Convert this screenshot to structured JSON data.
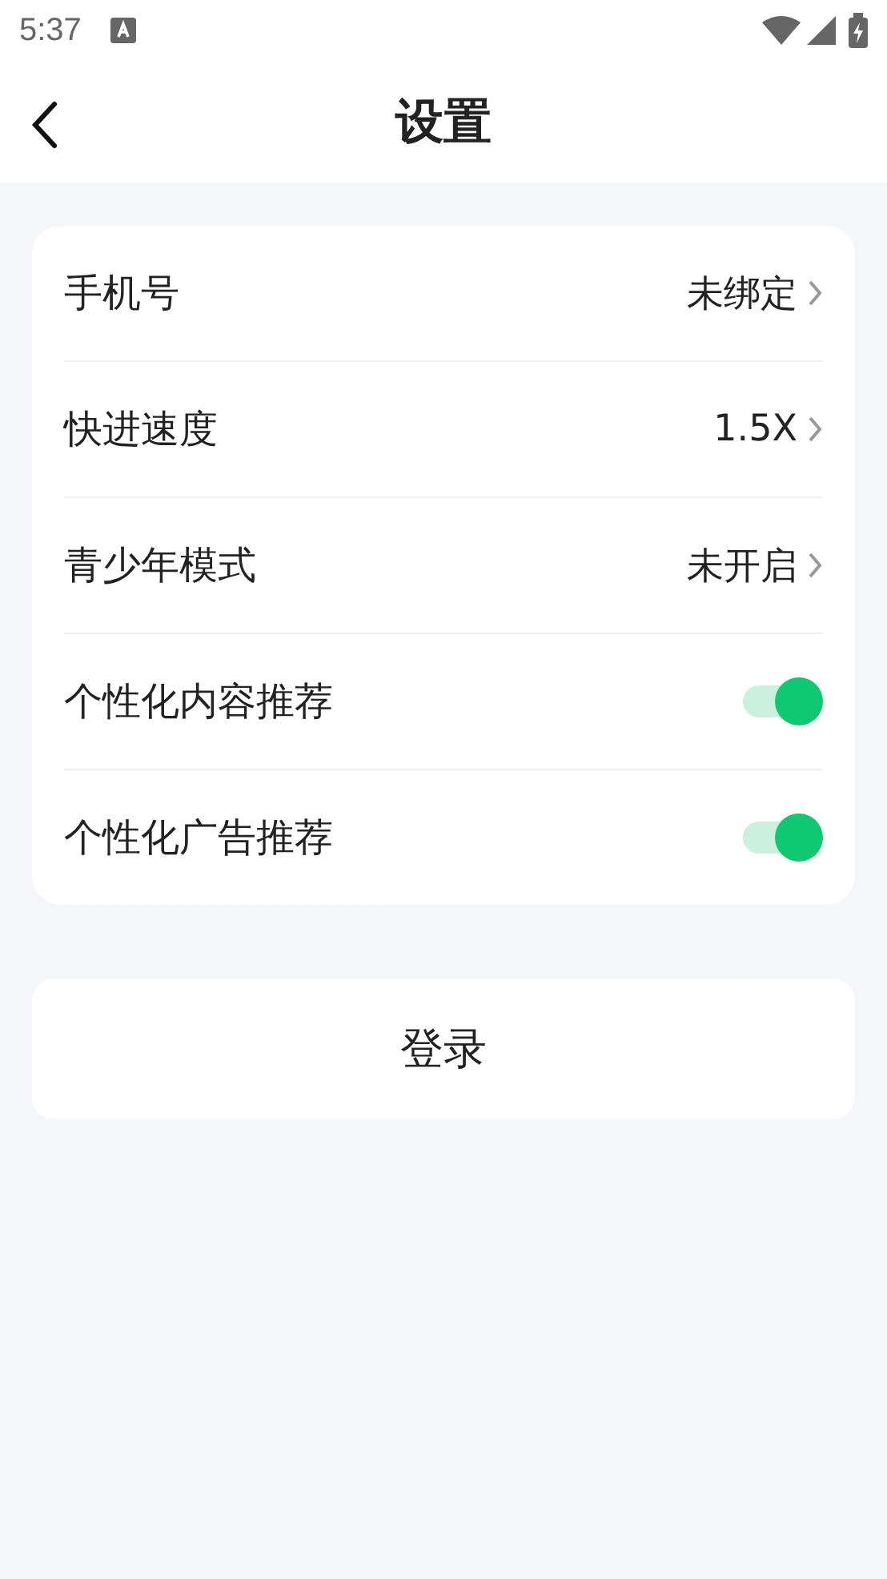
{
  "status_bar": {
    "time": "5:37"
  },
  "header": {
    "title": "设置"
  },
  "settings": [
    {
      "kind": "link",
      "label": "手机号",
      "value": "未绑定"
    },
    {
      "kind": "link",
      "label": "快进速度",
      "value": "1.5X"
    },
    {
      "kind": "link",
      "label": "青少年模式",
      "value": "未开启"
    },
    {
      "kind": "switch",
      "label": "个性化内容推荐",
      "on": true
    },
    {
      "kind": "switch",
      "label": "个性化广告推荐",
      "on": true
    }
  ],
  "login_button": "登录"
}
